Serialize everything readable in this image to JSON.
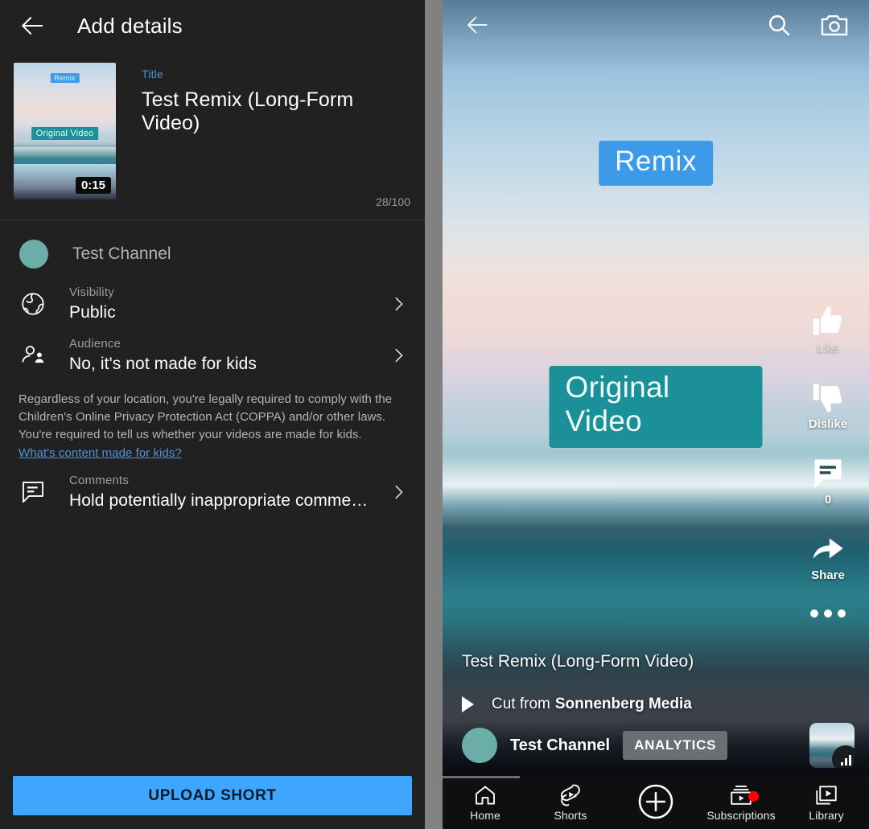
{
  "left": {
    "header": {
      "back_icon": "back-arrow-icon",
      "title": "Add details"
    },
    "thumbnail": {
      "remix_badge": "Remix",
      "original_badge": "Original Video",
      "duration": "0:15"
    },
    "title_field": {
      "label": "Title",
      "value": "Test Remix (Long-Form Video)",
      "char_count": "28/100"
    },
    "channel": {
      "name": "Test Channel"
    },
    "settings": [
      {
        "icon": "globe-icon",
        "label": "Visibility",
        "value": "Public",
        "chevron": "chevron-right-icon"
      },
      {
        "icon": "audience-people-icon",
        "label": "Audience",
        "value": "No, it's not made for kids",
        "chevron": "chevron-right-icon"
      }
    ],
    "coppa": {
      "body": "Regardless of your location, you're legally required to comply with the Children's Online Privacy Protection Act (COPPA) and/or other laws. You're required to tell us whether your videos are made for kids.",
      "link": "What's content made for kids?"
    },
    "comments": {
      "icon": "comment-icon",
      "label": "Comments",
      "value": "Hold potentially inappropriate comme…",
      "chevron": "chevron-right-icon"
    },
    "upload_button": "UPLOAD SHORT"
  },
  "right": {
    "topbar": {
      "back_icon": "back-arrow-icon",
      "search_icon": "search-icon",
      "camera_icon": "camera-icon"
    },
    "overlays": {
      "remix": "Remix",
      "original": "Original Video"
    },
    "rail": [
      {
        "icon": "thumbs-up-icon",
        "label": "Like"
      },
      {
        "icon": "thumbs-down-icon",
        "label": "Dislike"
      },
      {
        "icon": "comment-icon",
        "label": "0"
      },
      {
        "icon": "share-icon",
        "label": "Share"
      },
      {
        "icon": "more-dots-icon",
        "label": ""
      }
    ],
    "video_title": "Test Remix (Long-Form Video)",
    "cut_from": {
      "prefix": "Cut from",
      "source": "Sonnenberg Media",
      "icon": "play-icon"
    },
    "channel_bar": {
      "name": "Test Channel",
      "analytics_label": "ANALYTICS",
      "mini_thumb": "video-thumbnail",
      "mini_badge": "analytics-bars-icon"
    },
    "bottom_nav": [
      {
        "icon": "home-icon",
        "label": "Home",
        "badge": false
      },
      {
        "icon": "shorts-icon",
        "label": "Shorts",
        "badge": false
      },
      {
        "icon": "plus-circle-icon",
        "label": "",
        "badge": false
      },
      {
        "icon": "subscriptions-icon",
        "label": "Subscriptions",
        "badge": true
      },
      {
        "icon": "library-icon",
        "label": "Library",
        "badge": false
      }
    ]
  },
  "colors": {
    "accent_blue": "#3ea6ff",
    "link_blue": "#4e92d4",
    "remix_badge": "#3c9ae8",
    "original_badge": "#1c9099",
    "avatar": "#6aada9",
    "panel_bg": "#212121",
    "notification_red": "#ff0000"
  }
}
